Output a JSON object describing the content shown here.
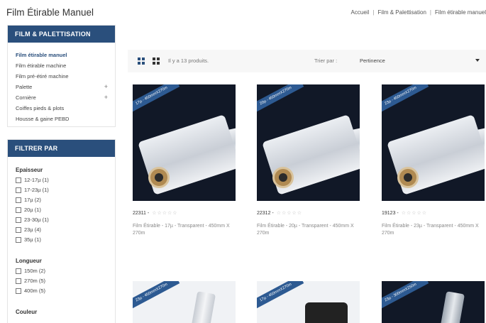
{
  "page_title": "Film Étirable Manuel",
  "breadcrumb": [
    "Accueil",
    "Film & Palettisation",
    "Film étirable manuel"
  ],
  "categories": {
    "title": "FILM & PALETTISATION",
    "items": [
      {
        "label": "Film étirable manuel",
        "active": true
      },
      {
        "label": "Film étirable machine"
      },
      {
        "label": "Film pré-étiré machine"
      },
      {
        "label": "Palette",
        "expandable": true
      },
      {
        "label": "Cornière",
        "expandable": true
      },
      {
        "label": "Coiffes pieds & plots"
      },
      {
        "label": "Housse & gaine PEBD"
      }
    ]
  },
  "filters": {
    "title": "FILTRER PAR",
    "groups": [
      {
        "title": "Epaisseur",
        "options": [
          "12-17µ (1)",
          "17-23µ (1)",
          "17µ (2)",
          "20µ (1)",
          "23-30µ (1)",
          "23µ (4)",
          "35µ (1)"
        ]
      },
      {
        "title": "Longueur",
        "options": [
          "150m (2)",
          "270m (5)",
          "400m (5)"
        ]
      },
      {
        "title": "Couleur",
        "options": []
      }
    ]
  },
  "toolbar": {
    "count_text": "Il y a 13 produits.",
    "sort_label": "Trier par :",
    "sort_value": "Pertinence"
  },
  "products": [
    {
      "ref": "22311",
      "ribbon": "17µ - 450mmX270m",
      "name": "Film Étirable - 17µ - Transparent - 450mm X 270m"
    },
    {
      "ref": "22312",
      "ribbon": "20µ - 450mmX270m",
      "name": "Film Étirable - 20µ - Transparent - 450mm X 270m"
    },
    {
      "ref": "19123",
      "ribbon": "23µ - 450mmX270m",
      "name": "Film Étirable - 23µ - Transparent - 450mm X 270m"
    }
  ],
  "products_row2": [
    {
      "ribbon": "23µ - 450mmX270m"
    },
    {
      "ribbon": "17µ - 450mmX270m"
    },
    {
      "ribbon": "23µ - 300mmX250m"
    }
  ],
  "colors": {
    "accent": "#2a4f7c",
    "ribbon": "#2d5a92"
  }
}
